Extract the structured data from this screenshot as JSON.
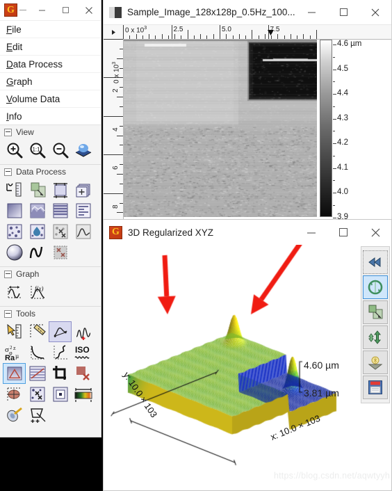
{
  "main_window": {
    "title_icon": "gwyddion-app-icon",
    "controls": {
      "minimize": "–",
      "maximize": "▢",
      "close": "✕"
    },
    "menu": [
      {
        "label": "File",
        "mnemonic": "F"
      },
      {
        "label": "Edit",
        "mnemonic": "E"
      },
      {
        "label": "Data Process",
        "mnemonic": "D"
      },
      {
        "label": "Graph",
        "mnemonic": "G"
      },
      {
        "label": "Volume Data",
        "mnemonic": "V"
      },
      {
        "label": "Info",
        "mnemonic": "I"
      }
    ],
    "sections": [
      {
        "name": "View",
        "icons": [
          {
            "name": "zoom-in-icon",
            "selected": false
          },
          {
            "name": "zoom-1to1-icon",
            "selected": false
          },
          {
            "name": "zoom-out-icon",
            "selected": false
          },
          {
            "name": "view-3d-icon",
            "selected": false
          }
        ]
      },
      {
        "name": "Data Process",
        "icons": [
          {
            "name": "level-plane-icon",
            "selected": false
          },
          {
            "name": "merge-layers-icon",
            "selected": false
          },
          {
            "name": "crop-bounds-icon",
            "selected": false
          },
          {
            "name": "arithmetic-icon",
            "selected": false
          },
          {
            "name": "gradient-icon",
            "selected": false
          },
          {
            "name": "roughness-surface-icon",
            "selected": false
          },
          {
            "name": "line-correct-icon",
            "selected": false
          },
          {
            "name": "statistics-rows-icon",
            "selected": false
          },
          {
            "name": "grain-mark-icon",
            "selected": false
          },
          {
            "name": "grain-drop-icon",
            "selected": false
          },
          {
            "name": "grain-remove-icon",
            "selected": false
          },
          {
            "name": "distribution-icon",
            "selected": false
          },
          {
            "name": "sphere-revolve-icon",
            "selected": false
          },
          {
            "name": "wave-filter-icon",
            "selected": false
          },
          {
            "name": "mask-remove-icon",
            "selected": false
          }
        ]
      },
      {
        "name": "Graph",
        "icons": [
          {
            "name": "graph-measure-icon",
            "selected": false
          },
          {
            "name": "graph-function-icon",
            "selected": false
          }
        ]
      },
      {
        "name": "Tools",
        "icons": [
          {
            "name": "read-value-icon",
            "selected": false
          },
          {
            "name": "measure-distance-icon",
            "selected": false
          },
          {
            "name": "profile-extract-icon",
            "selected": true
          },
          {
            "name": "spectro-point-icon",
            "selected": false
          },
          {
            "name": "statistical-quantities-icon",
            "selected": false
          },
          {
            "name": "stats-1d-icon",
            "selected": false
          },
          {
            "name": "line-stats-icon",
            "selected": false
          },
          {
            "name": "iso-roughness-icon",
            "selected": false
          },
          {
            "name": "level-three-point-icon",
            "selected": true
          },
          {
            "name": "path-level-icon",
            "selected": false
          },
          {
            "name": "crop-tool-icon",
            "selected": false
          },
          {
            "name": "mask-editor-icon",
            "selected": false
          },
          {
            "name": "grain-measure-icon",
            "selected": false
          },
          {
            "name": "grain-remove-tool-icon",
            "selected": false
          },
          {
            "name": "selection-manager-icon",
            "selected": false
          },
          {
            "name": "color-range-icon",
            "selected": false
          },
          {
            "name": "filters-icon",
            "selected": false
          },
          {
            "name": "distance-add-icon",
            "selected": false
          }
        ]
      }
    ]
  },
  "image_window": {
    "title": "Sample_Image_128x128p_0.5Hz_100...",
    "title_icon": "thumbnail-icon",
    "controls": {
      "minimize": "–",
      "maximize": "▢",
      "close": "✕"
    },
    "h_ruler": {
      "labels": [
        "0 x 10",
        "2.5",
        "5.0",
        "7.5"
      ],
      "exponent": "3"
    },
    "v_ruler": {
      "labels": [
        "0 x 10",
        "2",
        "4",
        "6",
        "8"
      ],
      "exponent": "3"
    },
    "color_scale": {
      "unit": "µm",
      "ticks": [
        "4.6 µm",
        "4.5",
        "4.4",
        "4.3",
        "4.2",
        "4.1",
        "4.0",
        "3.9"
      ],
      "min": 3.9,
      "max": 4.6
    }
  },
  "window_3d": {
    "title": "3D Regularized XYZ",
    "title_icon": "gwyddion-app-icon",
    "controls": {
      "minimize": "–",
      "maximize": "▢",
      "close": "✕"
    },
    "axis_x_label": "x: 10.0 × 103",
    "axis_y_label": "y: 10.0 × 103",
    "z_max_label": "4.60 µm",
    "z_min_label": "3.81 µm",
    "annotations": [
      {
        "name": "red-arrow-left",
        "points_to": "left peak"
      },
      {
        "name": "red-arrow-right",
        "points_to": "right peak"
      }
    ],
    "toolbar": [
      {
        "name": "rewind-view-icon",
        "active": false
      },
      {
        "name": "rotate-view-icon",
        "active": true
      },
      {
        "name": "scale-view-icon",
        "active": false
      },
      {
        "name": "z-scale-icon",
        "active": false
      },
      {
        "name": "light-source-icon",
        "active": false
      },
      {
        "name": "save-image-icon",
        "active": false
      }
    ]
  },
  "watermark": "https://blog.csdn.net/aqwtyyh",
  "colors": {
    "accent_blue": "#3e90d8",
    "selection_violet": "#d8d9f0",
    "arrow_red": "#f01c12",
    "surface_yellow": "#d9c21c",
    "surface_green": "#3fa83f",
    "surface_blue": "#2233a8",
    "app_orange": "#c03a12"
  }
}
